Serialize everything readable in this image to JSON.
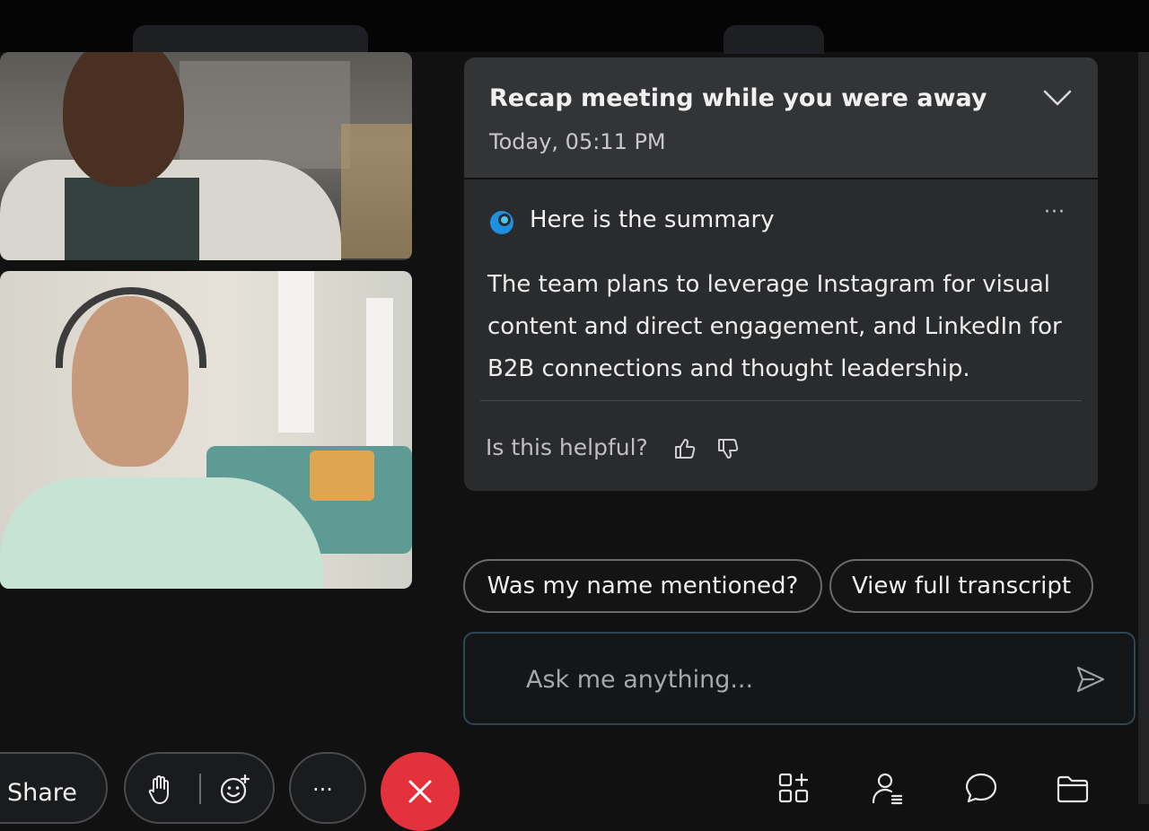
{
  "recap": {
    "title": "Recap meeting while you were away",
    "timestamp": "Today, 05:11 PM"
  },
  "summary": {
    "heading": "Here is the summary",
    "more_label": "···",
    "text": "The team plans to leverage Instagram for visual content and direct engagement, and LinkedIn for B2B connections and thought leadership.",
    "feedback_prompt": "Is this helpful?"
  },
  "suggestions": [
    {
      "label": "Was my name mentioned?"
    },
    {
      "label": "View full transcript"
    }
  ],
  "ask": {
    "placeholder": "Ask me anything..."
  },
  "controls": {
    "share_label": "Share",
    "more_label": "···"
  },
  "colors": {
    "end_call": "#e3323b",
    "card_header": "#333436",
    "card_body": "#2a2b2d",
    "input_border": "#2c4656"
  },
  "icons": {
    "collapse": "chevron-down-icon",
    "assistant": "assistant-logo-icon",
    "thumbs_up": "thumbs-up-icon",
    "thumbs_down": "thumbs-down-icon",
    "send": "send-icon",
    "hand": "raise-hand-icon",
    "reactions": "reactions-icon",
    "end_call": "end-call-icon",
    "apps": "apps-icon",
    "participants": "participants-icon",
    "chat": "chat-icon",
    "files": "files-icon"
  }
}
